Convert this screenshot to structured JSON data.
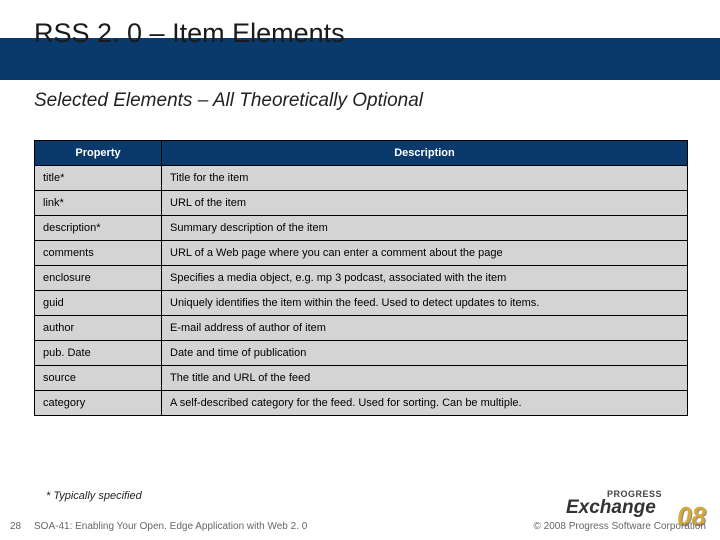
{
  "title": "RSS 2. 0 – Item Elements",
  "subtitle": "Selected Elements – All Theoretically Optional",
  "table": {
    "headers": {
      "property": "Property",
      "description": "Description"
    },
    "rows": [
      {
        "property": "title*",
        "description": "Title for the item"
      },
      {
        "property": "link*",
        "description": "URL of the item"
      },
      {
        "property": "description*",
        "description": "Summary description of the item"
      },
      {
        "property": "comments",
        "description": "URL of a Web page where you can enter a comment about the page"
      },
      {
        "property": "enclosure",
        "description": "Specifies a media object, e.g. mp 3 podcast, associated with the item"
      },
      {
        "property": "guid",
        "description": "Uniquely identifies the item within the feed. Used to detect updates to items."
      },
      {
        "property": "author",
        "description": "E-mail address of author of item"
      },
      {
        "property": "pub. Date",
        "description": "Date and time of publication"
      },
      {
        "property": "source",
        "description": "The title and URL of the feed"
      },
      {
        "property": "category",
        "description": "A self-described category for the feed.  Used for sorting. Can be multiple."
      }
    ]
  },
  "footnote": "* Typically specified",
  "footer": {
    "slide_number": "28",
    "session": "SOA-41: Enabling Your Open. Edge Application with Web 2. 0",
    "copyright": "© 2008 Progress Software Corporation"
  },
  "logo": {
    "line1": "PROGRESS",
    "line2": "Exchange",
    "badge": "08"
  }
}
